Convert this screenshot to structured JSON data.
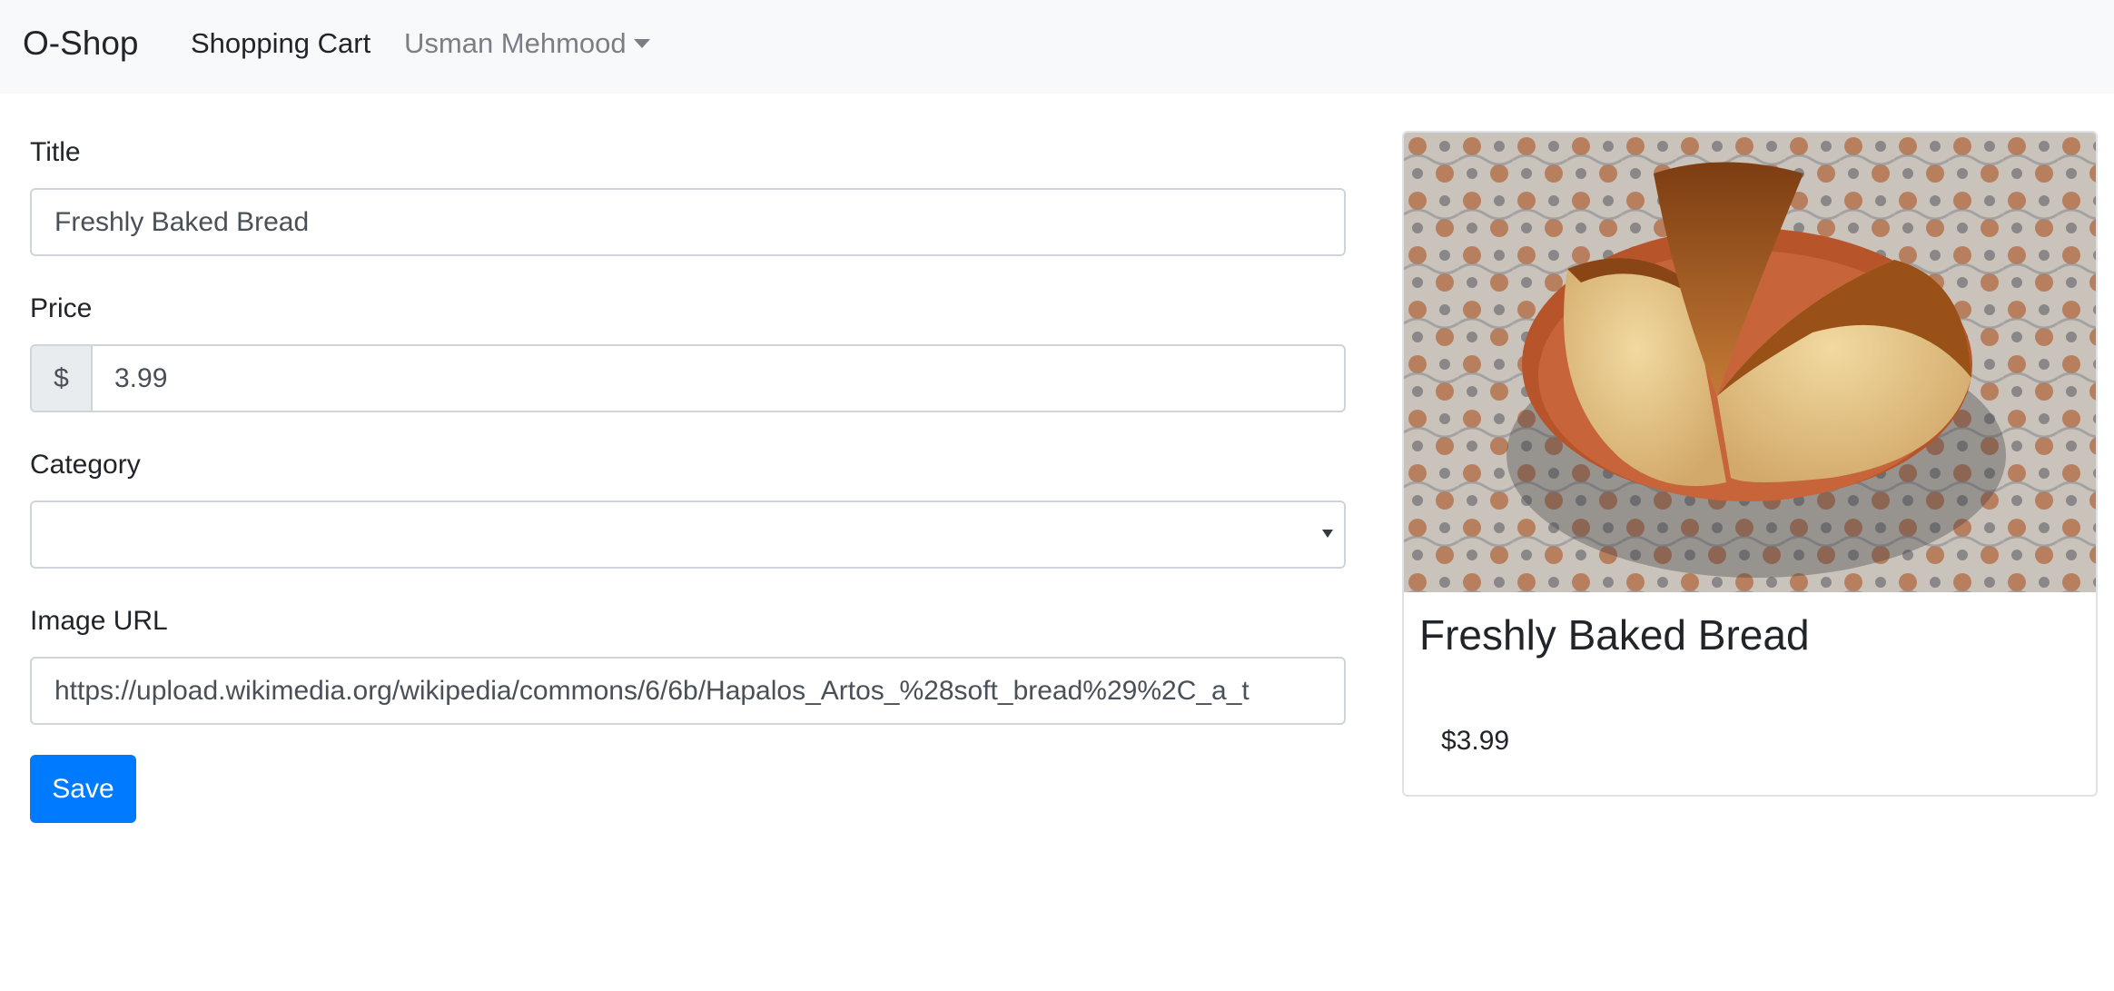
{
  "navbar": {
    "brand": "O-Shop",
    "links": [
      {
        "label": "Shopping Cart"
      },
      {
        "label": "Usman Mehmood"
      }
    ]
  },
  "form": {
    "title": {
      "label": "Title",
      "value": "Freshly Baked Bread"
    },
    "price": {
      "label": "Price",
      "prefix": "$",
      "value": "3.99"
    },
    "category": {
      "label": "Category",
      "value": ""
    },
    "image_url": {
      "label": "Image URL",
      "value": "https://upload.wikimedia.org/wikipedia/commons/6/6b/Hapalos_Artos_%28soft_bread%29%2C_a_t"
    },
    "save_label": "Save"
  },
  "card": {
    "title": "Freshly Baked Bread",
    "price": "$3.99",
    "image_icon": "bread-photo"
  },
  "colors": {
    "navbar_bg": "#f8f9fa",
    "primary": "#007bff",
    "border": "#ced4da",
    "addon_bg": "#e9ecef"
  }
}
